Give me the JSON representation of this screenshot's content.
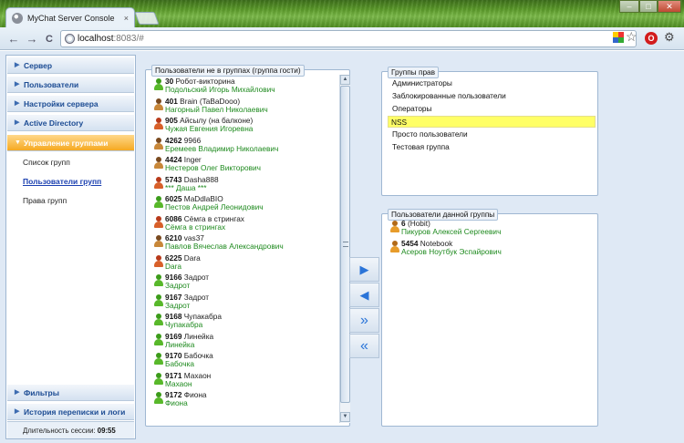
{
  "browser": {
    "tab_title": "MyChat Server Console",
    "tab_close": "×",
    "url_host": "localhost",
    "url_rest": ":8083/#",
    "nav_back": "←",
    "nav_forward": "→",
    "nav_reload": "C",
    "star": "☆",
    "opera": "O",
    "wrench": "🔧",
    "win_min": "–",
    "win_max": "□",
    "win_close": "✕"
  },
  "sidebar": {
    "sections": [
      {
        "label": "Сервер"
      },
      {
        "label": "Пользователи"
      },
      {
        "label": "Настройки сервера"
      },
      {
        "label": "Active Directory"
      },
      {
        "label": "Управление группами"
      }
    ],
    "sublinks": [
      {
        "label": "Список групп"
      },
      {
        "label": "Пользователи групп"
      },
      {
        "label": "Права групп"
      }
    ],
    "bottom_sections": [
      {
        "label": "Фильтры"
      },
      {
        "label": "История переписки и логи"
      }
    ],
    "session_label": "Длительность сессии:",
    "session_value": "09:55"
  },
  "ungrouped": {
    "title": "Пользователи не в группах (группа гости)",
    "users": [
      {
        "uid": "30",
        "nick": "Робот-викторина",
        "name": "Подольский Игорь Михайлович",
        "icon": "green"
      },
      {
        "uid": "401",
        "nick": "Brain (TaBaDooo)",
        "name": "Нагорный Павел Николаевич",
        "icon": "brown"
      },
      {
        "uid": "905",
        "nick": "Айсылу (на балконе)",
        "name": "Чужая Евгения Игоревна",
        "icon": "red"
      },
      {
        "uid": "4262",
        "nick": "9966",
        "name": "Еремеев Владимир Николаевич",
        "icon": "brown"
      },
      {
        "uid": "4424",
        "nick": "Inger",
        "name": "Нестеров Олег Викторович",
        "icon": "brown"
      },
      {
        "uid": "5743",
        "nick": "Dasha888",
        "name": "*** Даша ***",
        "icon": "red"
      },
      {
        "uid": "6025",
        "nick": "MaDdlaBIO",
        "name": "Пестов Андрей Леонидович",
        "icon": "green"
      },
      {
        "uid": "6086",
        "nick": "Сёмга в стрингах",
        "name": "Сёмга в стрингах",
        "icon": "red"
      },
      {
        "uid": "6210",
        "nick": "vas37",
        "name": "Павлов Вячеслав Александрович",
        "icon": "brown"
      },
      {
        "uid": "6225",
        "nick": "Dara",
        "name": "Dara",
        "icon": "red"
      },
      {
        "uid": "9166",
        "nick": "Задрот",
        "name": "Задрот",
        "icon": "green"
      },
      {
        "uid": "9167",
        "nick": "Задрот",
        "name": "Задрот",
        "icon": "green"
      },
      {
        "uid": "9168",
        "nick": "Чупакабра",
        "name": "Чупакабра",
        "icon": "green"
      },
      {
        "uid": "9169",
        "nick": "Линейка",
        "name": "Линейка",
        "icon": "green"
      },
      {
        "uid": "9170",
        "nick": "Бабочка",
        "name": "Бабочка",
        "icon": "green"
      },
      {
        "uid": "9171",
        "nick": "Махаон",
        "name": "Махаон",
        "icon": "green"
      },
      {
        "uid": "9172",
        "nick": "Фиона",
        "name": "Фиона",
        "icon": "green"
      }
    ]
  },
  "rights_groups": {
    "title": "Группы прав",
    "items": [
      {
        "label": "Администраторы"
      },
      {
        "label": "Заблокированные пользователи"
      },
      {
        "label": "Операторы"
      },
      {
        "label": "NSS",
        "selected": true
      },
      {
        "label": "Просто пользователи"
      },
      {
        "label": "Тестовая группа"
      }
    ]
  },
  "group_users": {
    "title": "Пользователи данной группы",
    "users": [
      {
        "uid": "6",
        "nick": "(Hobit)",
        "name": "Пикуров Алексей Сергеевич",
        "icon": "orange"
      },
      {
        "uid": "5454",
        "nick": "Notebook",
        "name": "Асеров Ноутбук Эспайрович",
        "icon": "orange"
      }
    ]
  },
  "move_buttons": [
    {
      "glyph": "▶",
      "action": "add"
    },
    {
      "glyph": "◀",
      "action": "remove"
    },
    {
      "glyph": "»",
      "action": "add-all"
    },
    {
      "glyph": "«",
      "action": "remove-all"
    }
  ]
}
